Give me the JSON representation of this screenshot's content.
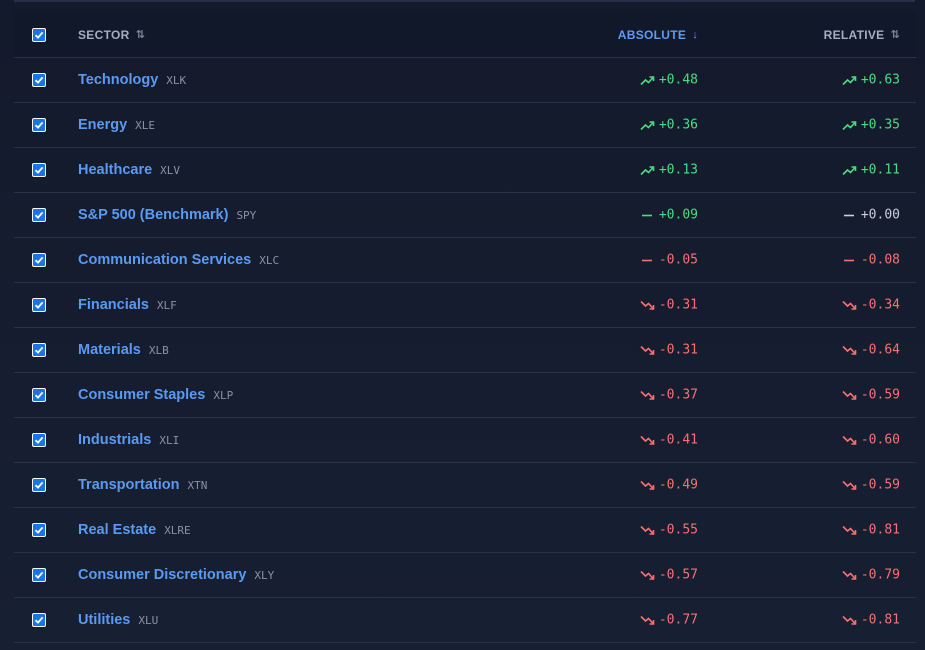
{
  "header": {
    "sector": "SECTOR",
    "absolute": "ABSOLUTE",
    "relative": "RELATIVE",
    "sort_neutral": "⇅",
    "sort_down": "↓"
  },
  "colors": {
    "accent": "#5a9af2",
    "positive": "#4ade80",
    "negative": "#f87171",
    "neutral": "#c9cfdb",
    "checkbox": "#1a73e8"
  },
  "rows": [
    {
      "name": "Technology",
      "ticker": "XLK",
      "abs": "+0.48",
      "abs_trend": "up",
      "rel": "+0.63",
      "rel_trend": "up"
    },
    {
      "name": "Energy",
      "ticker": "XLE",
      "abs": "+0.36",
      "abs_trend": "up",
      "rel": "+0.35",
      "rel_trend": "up"
    },
    {
      "name": "Healthcare",
      "ticker": "XLV",
      "abs": "+0.13",
      "abs_trend": "up",
      "rel": "+0.11",
      "rel_trend": "up"
    },
    {
      "name": "S&P 500 (Benchmark)",
      "ticker": "SPY",
      "abs": "+0.09",
      "abs_trend": "flat-g",
      "rel": "+0.00",
      "rel_trend": "flat-n"
    },
    {
      "name": "Communication Services",
      "ticker": "XLC",
      "abs": "-0.05",
      "abs_trend": "flat-r",
      "rel": "-0.08",
      "rel_trend": "flat-r"
    },
    {
      "name": "Financials",
      "ticker": "XLF",
      "abs": "-0.31",
      "abs_trend": "down",
      "rel": "-0.34",
      "rel_trend": "down"
    },
    {
      "name": "Materials",
      "ticker": "XLB",
      "abs": "-0.31",
      "abs_trend": "down",
      "rel": "-0.64",
      "rel_trend": "down"
    },
    {
      "name": "Consumer Staples",
      "ticker": "XLP",
      "abs": "-0.37",
      "abs_trend": "down",
      "rel": "-0.59",
      "rel_trend": "down"
    },
    {
      "name": "Industrials",
      "ticker": "XLI",
      "abs": "-0.41",
      "abs_trend": "down",
      "rel": "-0.60",
      "rel_trend": "down"
    },
    {
      "name": "Transportation",
      "ticker": "XTN",
      "abs": "-0.49",
      "abs_trend": "down",
      "rel": "-0.59",
      "rel_trend": "down"
    },
    {
      "name": "Real Estate",
      "ticker": "XLRE",
      "abs": "-0.55",
      "abs_trend": "down",
      "rel": "-0.81",
      "rel_trend": "down"
    },
    {
      "name": "Consumer Discretionary",
      "ticker": "XLY",
      "abs": "-0.57",
      "abs_trend": "down",
      "rel": "-0.79",
      "rel_trend": "down"
    },
    {
      "name": "Utilities",
      "ticker": "XLU",
      "abs": "-0.77",
      "abs_trend": "down",
      "rel": "-0.81",
      "rel_trend": "down"
    }
  ]
}
